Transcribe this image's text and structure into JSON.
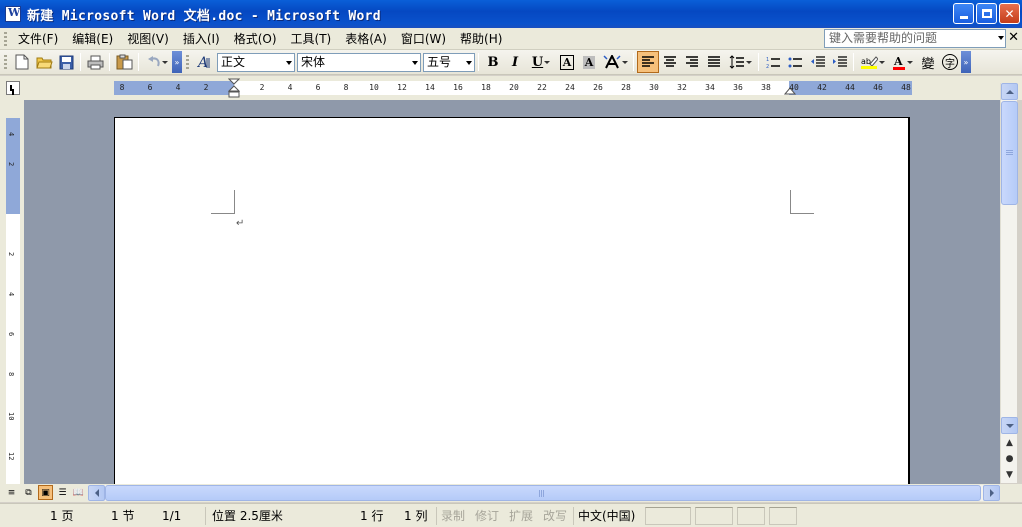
{
  "window": {
    "title": "新建 Microsoft Word 文档.doc - Microsoft Word"
  },
  "menu": {
    "items": [
      "文件(F)",
      "编辑(E)",
      "视图(V)",
      "插入(I)",
      "格式(O)",
      "工具(T)",
      "表格(A)",
      "窗口(W)",
      "帮助(H)"
    ],
    "help_placeholder": "键入需要帮助的问题"
  },
  "toolbar": {
    "style": "正文",
    "font": "宋体",
    "size": "五号",
    "bold": "B",
    "italic": "I",
    "underline": "U",
    "char_border": "A",
    "char_shading": "A",
    "font_color_letter": "A",
    "phonetic": "變",
    "enclose": "字",
    "accent_color": "#f6c07b",
    "highlight_color": "#ffff00",
    "font_color": "#ff0000"
  },
  "ruler": {
    "left_labels": [
      "8",
      "6",
      "4",
      "2"
    ],
    "right_labels": [
      "2",
      "4",
      "6",
      "8",
      "10",
      "12",
      "14",
      "16",
      "18",
      "20",
      "22",
      "24",
      "26",
      "28",
      "30",
      "32",
      "34",
      "36",
      "38",
      "40",
      "42",
      "44",
      "46",
      "48"
    ],
    "vertical_labels": [
      "4",
      "2",
      "2",
      "4",
      "6",
      "8",
      "10",
      "12"
    ]
  },
  "document": {
    "paragraph_mark": "↵"
  },
  "statusbar": {
    "page": "1 页",
    "section": "1 节",
    "page_of": "1/1",
    "position": "位置 2.5厘米",
    "line": "1 行",
    "column": "1 列",
    "rec": "录制",
    "trk": "修订",
    "ext": "扩展",
    "ovr": "改写",
    "language": "中文(中国)"
  }
}
